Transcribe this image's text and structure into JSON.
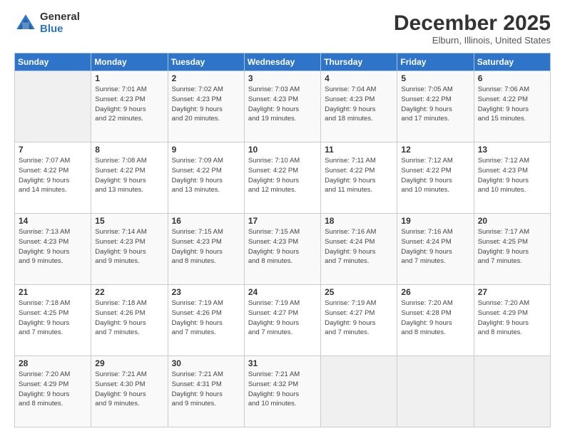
{
  "logo": {
    "general": "General",
    "blue": "Blue"
  },
  "header": {
    "month": "December 2025",
    "location": "Elburn, Illinois, United States"
  },
  "days_of_week": [
    "Sunday",
    "Monday",
    "Tuesday",
    "Wednesday",
    "Thursday",
    "Friday",
    "Saturday"
  ],
  "weeks": [
    [
      {
        "day": "",
        "info": ""
      },
      {
        "day": "1",
        "info": "Sunrise: 7:01 AM\nSunset: 4:23 PM\nDaylight: 9 hours\nand 22 minutes."
      },
      {
        "day": "2",
        "info": "Sunrise: 7:02 AM\nSunset: 4:23 PM\nDaylight: 9 hours\nand 20 minutes."
      },
      {
        "day": "3",
        "info": "Sunrise: 7:03 AM\nSunset: 4:23 PM\nDaylight: 9 hours\nand 19 minutes."
      },
      {
        "day": "4",
        "info": "Sunrise: 7:04 AM\nSunset: 4:23 PM\nDaylight: 9 hours\nand 18 minutes."
      },
      {
        "day": "5",
        "info": "Sunrise: 7:05 AM\nSunset: 4:22 PM\nDaylight: 9 hours\nand 17 minutes."
      },
      {
        "day": "6",
        "info": "Sunrise: 7:06 AM\nSunset: 4:22 PM\nDaylight: 9 hours\nand 15 minutes."
      }
    ],
    [
      {
        "day": "7",
        "info": "Sunrise: 7:07 AM\nSunset: 4:22 PM\nDaylight: 9 hours\nand 14 minutes."
      },
      {
        "day": "8",
        "info": "Sunrise: 7:08 AM\nSunset: 4:22 PM\nDaylight: 9 hours\nand 13 minutes."
      },
      {
        "day": "9",
        "info": "Sunrise: 7:09 AM\nSunset: 4:22 PM\nDaylight: 9 hours\nand 13 minutes."
      },
      {
        "day": "10",
        "info": "Sunrise: 7:10 AM\nSunset: 4:22 PM\nDaylight: 9 hours\nand 12 minutes."
      },
      {
        "day": "11",
        "info": "Sunrise: 7:11 AM\nSunset: 4:22 PM\nDaylight: 9 hours\nand 11 minutes."
      },
      {
        "day": "12",
        "info": "Sunrise: 7:12 AM\nSunset: 4:22 PM\nDaylight: 9 hours\nand 10 minutes."
      },
      {
        "day": "13",
        "info": "Sunrise: 7:12 AM\nSunset: 4:23 PM\nDaylight: 9 hours\nand 10 minutes."
      }
    ],
    [
      {
        "day": "14",
        "info": "Sunrise: 7:13 AM\nSunset: 4:23 PM\nDaylight: 9 hours\nand 9 minutes."
      },
      {
        "day": "15",
        "info": "Sunrise: 7:14 AM\nSunset: 4:23 PM\nDaylight: 9 hours\nand 9 minutes."
      },
      {
        "day": "16",
        "info": "Sunrise: 7:15 AM\nSunset: 4:23 PM\nDaylight: 9 hours\nand 8 minutes."
      },
      {
        "day": "17",
        "info": "Sunrise: 7:15 AM\nSunset: 4:23 PM\nDaylight: 9 hours\nand 8 minutes."
      },
      {
        "day": "18",
        "info": "Sunrise: 7:16 AM\nSunset: 4:24 PM\nDaylight: 9 hours\nand 7 minutes."
      },
      {
        "day": "19",
        "info": "Sunrise: 7:16 AM\nSunset: 4:24 PM\nDaylight: 9 hours\nand 7 minutes."
      },
      {
        "day": "20",
        "info": "Sunrise: 7:17 AM\nSunset: 4:25 PM\nDaylight: 9 hours\nand 7 minutes."
      }
    ],
    [
      {
        "day": "21",
        "info": "Sunrise: 7:18 AM\nSunset: 4:25 PM\nDaylight: 9 hours\nand 7 minutes."
      },
      {
        "day": "22",
        "info": "Sunrise: 7:18 AM\nSunset: 4:26 PM\nDaylight: 9 hours\nand 7 minutes."
      },
      {
        "day": "23",
        "info": "Sunrise: 7:19 AM\nSunset: 4:26 PM\nDaylight: 9 hours\nand 7 minutes."
      },
      {
        "day": "24",
        "info": "Sunrise: 7:19 AM\nSunset: 4:27 PM\nDaylight: 9 hours\nand 7 minutes."
      },
      {
        "day": "25",
        "info": "Sunrise: 7:19 AM\nSunset: 4:27 PM\nDaylight: 9 hours\nand 7 minutes."
      },
      {
        "day": "26",
        "info": "Sunrise: 7:20 AM\nSunset: 4:28 PM\nDaylight: 9 hours\nand 8 minutes."
      },
      {
        "day": "27",
        "info": "Sunrise: 7:20 AM\nSunset: 4:29 PM\nDaylight: 9 hours\nand 8 minutes."
      }
    ],
    [
      {
        "day": "28",
        "info": "Sunrise: 7:20 AM\nSunset: 4:29 PM\nDaylight: 9 hours\nand 8 minutes."
      },
      {
        "day": "29",
        "info": "Sunrise: 7:21 AM\nSunset: 4:30 PM\nDaylight: 9 hours\nand 9 minutes."
      },
      {
        "day": "30",
        "info": "Sunrise: 7:21 AM\nSunset: 4:31 PM\nDaylight: 9 hours\nand 9 minutes."
      },
      {
        "day": "31",
        "info": "Sunrise: 7:21 AM\nSunset: 4:32 PM\nDaylight: 9 hours\nand 10 minutes."
      },
      {
        "day": "",
        "info": ""
      },
      {
        "day": "",
        "info": ""
      },
      {
        "day": "",
        "info": ""
      }
    ]
  ]
}
